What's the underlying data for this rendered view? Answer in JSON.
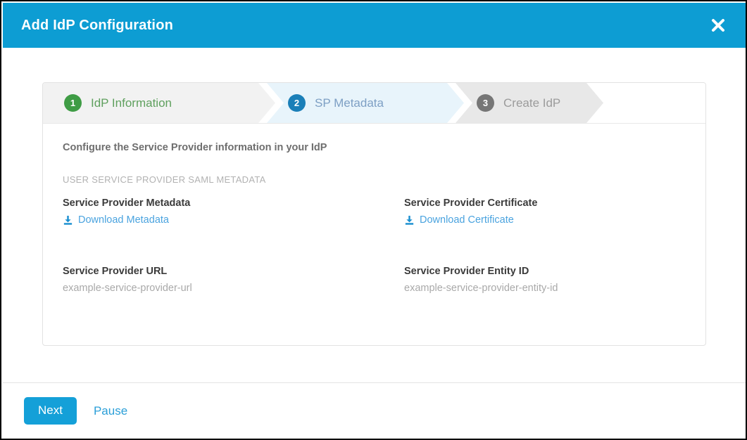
{
  "header": {
    "title": "Add IdP Configuration",
    "close_icon": "close-icon",
    "background_color": "#0d9dd3"
  },
  "stepper": {
    "steps": [
      {
        "number": "1",
        "label": "IdP Information",
        "state": "completed",
        "circle_color": "#3f9c45",
        "text_color": "#5fa05e",
        "chevron_color": "#f2f2f2"
      },
      {
        "number": "2",
        "label": "SP Metadata",
        "state": "active",
        "circle_color": "#1b7fb8",
        "text_color": "#7d9fc4",
        "chevron_color": "#e8f4fb"
      },
      {
        "number": "3",
        "label": "Create IdP",
        "state": "upcoming",
        "circle_color": "#767676",
        "text_color": "#9b9b9b",
        "chevron_color": "#e8e8e8"
      }
    ]
  },
  "content": {
    "intro": "Configure the Service Provider information in your IdP",
    "section_label": "USER SERVICE PROVIDER SAML METADATA",
    "fields": [
      {
        "title": "Service Provider Metadata",
        "type": "download",
        "link_label": "Download Metadata",
        "icon": "download-icon"
      },
      {
        "title": "Service Provider Certificate",
        "type": "download",
        "link_label": "Download Certificate",
        "icon": "download-icon"
      },
      {
        "title": "Service Provider URL",
        "type": "value",
        "value": "example-service-provider-url"
      },
      {
        "title": "Service Provider Entity ID",
        "type": "value",
        "value": "example-service-provider-entity-id"
      }
    ]
  },
  "footer": {
    "next_label": "Next",
    "pause_label": "Pause",
    "next_color": "#14a0d8",
    "pause_color": "#2b9fd8"
  }
}
